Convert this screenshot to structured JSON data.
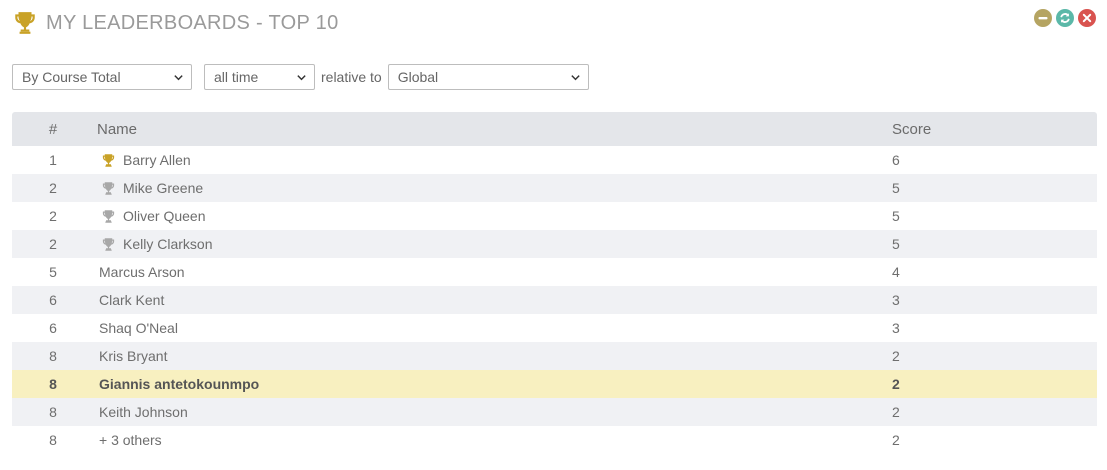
{
  "header": {
    "title": "MY LEADERBOARDS - TOP 10",
    "icon": "trophy-icon",
    "icon_color": "#c9a227"
  },
  "window_controls": {
    "minimize_color": "#b5a462",
    "refresh_color": "#5bb8a8",
    "close_color": "#d9534f"
  },
  "filters": {
    "sort_by": "By Course Total",
    "period": "all time",
    "relative_label": "relative to",
    "scope": "Global"
  },
  "table": {
    "headers": {
      "rank": "#",
      "name": "Name",
      "score": "Score"
    },
    "rows": [
      {
        "rank": "1",
        "name": "Barry Allen",
        "score": "6",
        "trophy": "gold"
      },
      {
        "rank": "2",
        "name": "Mike Greene",
        "score": "5",
        "trophy": "silver"
      },
      {
        "rank": "2",
        "name": "Oliver Queen",
        "score": "5",
        "trophy": "silver"
      },
      {
        "rank": "2",
        "name": "Kelly Clarkson",
        "score": "5",
        "trophy": "silver"
      },
      {
        "rank": "5",
        "name": "Marcus Arson",
        "score": "4",
        "trophy": ""
      },
      {
        "rank": "6",
        "name": "Clark Kent",
        "score": "3",
        "trophy": ""
      },
      {
        "rank": "6",
        "name": "Shaq O'Neal",
        "score": "3",
        "trophy": ""
      },
      {
        "rank": "8",
        "name": "Kris Bryant",
        "score": "2",
        "trophy": ""
      },
      {
        "rank": "8",
        "name": "Giannis antetokounmpo",
        "score": "2",
        "trophy": "",
        "current_user": true
      },
      {
        "rank": "8",
        "name": "Keith Johnson",
        "score": "2",
        "trophy": ""
      },
      {
        "rank": "8",
        "name": "+ 3 others",
        "score": "2",
        "trophy": ""
      }
    ],
    "colors": {
      "header_bg": "#e4e6ea",
      "alt_row_bg": "#f0f1f4",
      "highlight_bg": "#f8f0c0",
      "gold": "#c9a227",
      "silver": "#a8a8a8"
    }
  }
}
